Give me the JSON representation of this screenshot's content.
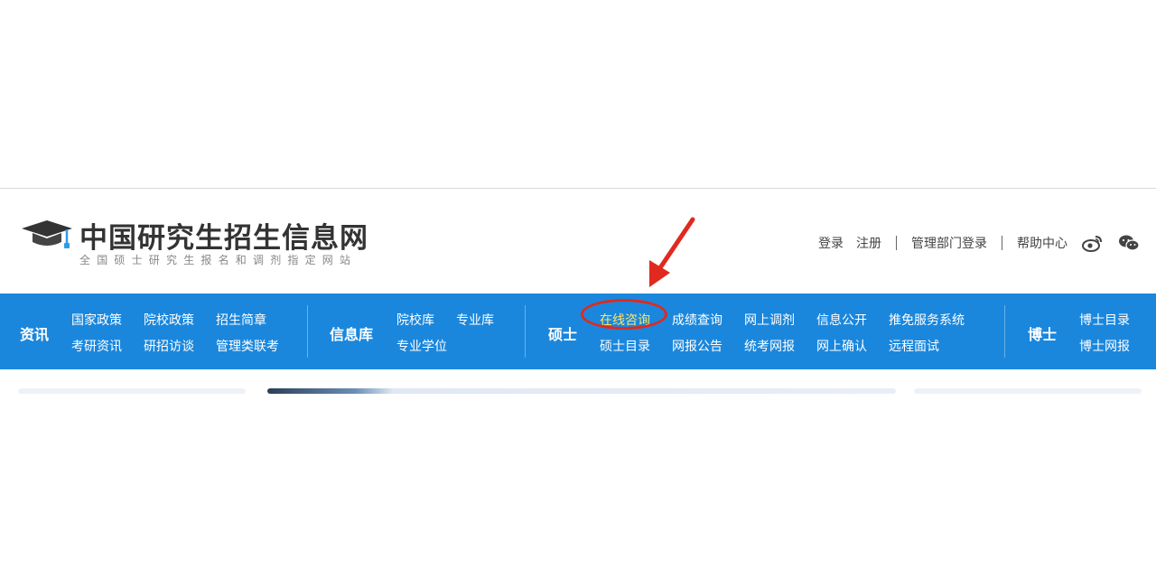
{
  "logo": {
    "title": "中国研究生招生信息网",
    "subtitle": "全国硕士研究生报名和调剂指定网站"
  },
  "top_links": {
    "login": "登录",
    "register": "注册",
    "admin_login": "管理部门登录",
    "help_center": "帮助中心"
  },
  "nav": {
    "news": {
      "title": "资讯",
      "links": [
        "国家政策",
        "院校政策",
        "招生简章",
        "考研资讯",
        "研招访谈",
        "管理类联考"
      ]
    },
    "infobase": {
      "title": "信息库",
      "links": [
        "院校库",
        "专业库",
        "专业学位"
      ]
    },
    "master": {
      "title": "硕士",
      "links": [
        "在线咨询",
        "成绩查询",
        "网上调剂",
        "信息公开",
        "推免服务系统",
        "硕士目录",
        "网报公告",
        "统考网报",
        "网上确认",
        "远程面试"
      ],
      "highlighted": "在线咨询",
      "highlight_color": "#ffe566"
    },
    "doctor": {
      "title": "博士",
      "links": [
        "博士目录",
        "博士网报"
      ]
    }
  },
  "colors": {
    "nav_background": "#1a87dd",
    "annotation_red": "#e02a1f",
    "logo_text": "#333333"
  },
  "icons": [
    "graduation-cap-icon",
    "weibo-icon",
    "wechat-icon",
    "red-arrow-annotation",
    "red-ellipse-annotation"
  ]
}
